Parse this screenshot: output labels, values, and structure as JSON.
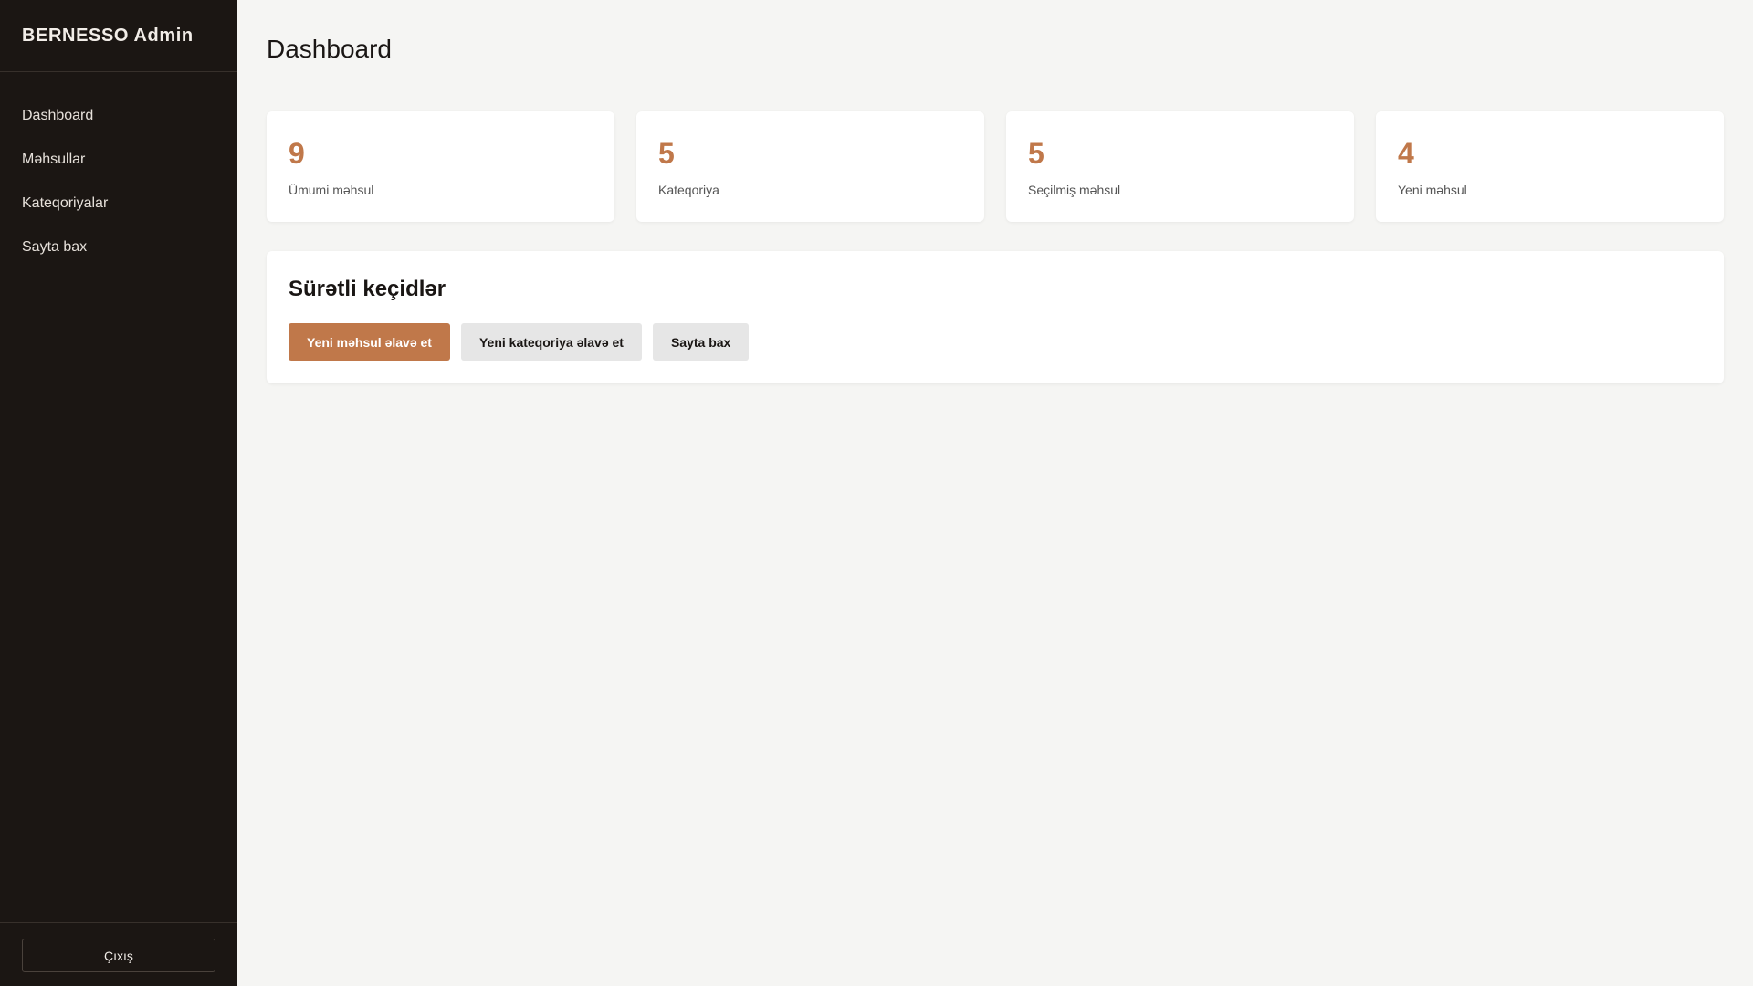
{
  "sidebar": {
    "brand": "BERNESSO Admin",
    "items": [
      {
        "label": "Dashboard"
      },
      {
        "label": "Məhsullar"
      },
      {
        "label": "Kateqoriyalar"
      },
      {
        "label": "Sayta bax"
      }
    ],
    "logout_label": "Çıxış"
  },
  "main": {
    "title": "Dashboard",
    "stats": [
      {
        "value": "9",
        "label": "Ümumi məhsul"
      },
      {
        "value": "5",
        "label": "Kateqoriya"
      },
      {
        "value": "5",
        "label": "Seçilmiş məhsul"
      },
      {
        "value": "4",
        "label": "Yeni məhsul"
      }
    ],
    "quick_links": {
      "title": "Sürətli keçidlər",
      "buttons": [
        {
          "label": "Yeni məhsul əlavə et"
        },
        {
          "label": "Yeni kateqoriya əlavə et"
        },
        {
          "label": "Sayta bax"
        }
      ]
    }
  },
  "colors": {
    "sidebar_bg": "#1b1613",
    "accent": "#c0784a",
    "page_bg": "#f5f5f3"
  }
}
